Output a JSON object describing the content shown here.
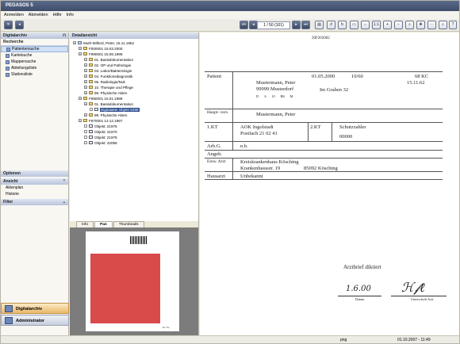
{
  "app": {
    "title": "PEGASOS 5"
  },
  "menu": [
    "Anmelden",
    "Abmelden",
    "Hilfe",
    "Info"
  ],
  "toolbar": {
    "record_nav": "1 / 50 (101)"
  },
  "left": {
    "header": "Digitalarchiv",
    "recherche": "Recherche",
    "items": [
      "Patientensuche",
      "Karteisuche",
      "Mappensuche",
      "Abteilungsliste",
      "Stationsliste"
    ],
    "options": "Optionen",
    "ansicht": "Ansicht",
    "ansicht_items": [
      "Aktenplan",
      "Historie"
    ],
    "filter": "Filter",
    "btn_digital": "Digitalarchiv",
    "btn_admin": "Administrator"
  },
  "detail": {
    "header": "Detailansicht",
    "tree": [
      "Muth-Milford, Peter, 15.11.1962",
      "F000001 15.03.2000",
      "F990001 15.06.1999",
      "01. Basisdokumentation",
      "02. OP und Pathologie",
      "03. Labor/Bakteriologie",
      "04. Funktionsdiagnostik",
      "05. Radiologie/Nuk",
      "10. Therapie und Pflege",
      "99. Physische Akten",
      "F990001 15.01.1998",
      "01. Basisdokumentation",
      "Digitalakte Objekt 6298",
      "99. Physische Akten",
      "F970001 12.12.1997",
      "Objekt: 21975",
      "Objekt: 21970",
      "Objekt: 21979",
      "Objekt: 22059"
    ],
    "tabs": [
      "Info",
      "Pan",
      "Thumbnails"
    ]
  },
  "document": {
    "header_code": "20F202002",
    "patient_label": "Patient",
    "name": "Mustermann, Peter",
    "city": "99999 Musterdorf",
    "street": "Im Graben 32",
    "dob": "15.11.62",
    "kk": "68 KC",
    "date": "01.05.2000",
    "id": "10/60",
    "hauptvers": "Haupt-\nvers.",
    "hauptvers_name": "Mustermann, Peter",
    "kt1": "1.KT",
    "aok": "AOK Ingolstadt",
    "aok_addr": "Postfach 21 02 41",
    "kt2": "2.KT",
    "schutz": "Schutzzahler",
    "num": "00000",
    "arbg": "Arb.G.",
    "nb": "n.b.",
    "angeh": "Angeh.",
    "einw": "Einw.\nArzt",
    "krankenhaus": "Kreiskrankenhaus Kösching",
    "kh_addr": "Krankenhausstr. 19",
    "kh_city": "85092 Kösching",
    "hausarzt": "Hausarzt",
    "unbekannt": "Unbekannt",
    "arztbrief": "Arztbrief diktiert",
    "sig_date": "1.6.00",
    "datum": "Datum",
    "unterschrift": "Unterschrift Arzt"
  },
  "status": {
    "format": "png",
    "datetime": "01.10.2007 - 11:49"
  }
}
